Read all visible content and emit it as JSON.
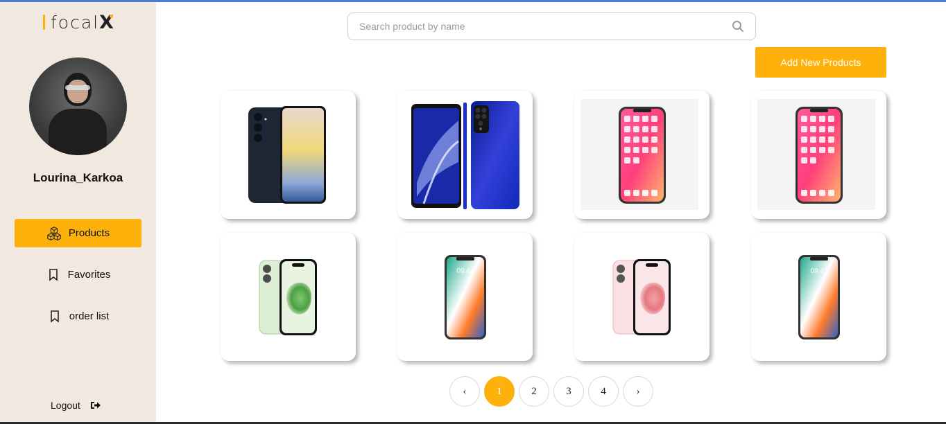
{
  "brand": {
    "logo_text": "focal",
    "logo_x": "X",
    "accent": "#fdb10a"
  },
  "user": {
    "name": "Lourina_Karkoa"
  },
  "sidebar": {
    "items": [
      {
        "label": "Products",
        "icon": "boxes-icon",
        "active": true
      },
      {
        "label": "Favorites",
        "icon": "bookmark-icon",
        "active": false
      },
      {
        "label": "order list",
        "icon": "bookmark-icon",
        "active": false
      }
    ],
    "logout_label": "Logout",
    "logout_icon": "sign-out-icon"
  },
  "search": {
    "placeholder": "Search product by name",
    "value": "",
    "icon": "search-icon"
  },
  "toolbar": {
    "add_label": "Add New Products"
  },
  "products": [
    {
      "name": "Samsung Galaxy navy"
    },
    {
      "name": "Blue Android phone"
    },
    {
      "name": "iPhone X"
    },
    {
      "name": "iPhone X"
    },
    {
      "name": "iPhone 15 green"
    },
    {
      "name": "iPhone X lock screen"
    },
    {
      "name": "iPhone 15 pink"
    },
    {
      "name": "iPhone X lock screen"
    }
  ],
  "pagination": {
    "prev": "‹",
    "next": "›",
    "pages": [
      "1",
      "2",
      "3",
      "4"
    ],
    "current": "1"
  }
}
